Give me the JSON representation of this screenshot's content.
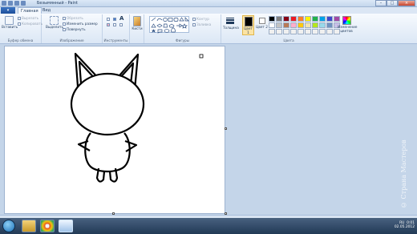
{
  "window": {
    "title": "Безымянный - Paint"
  },
  "tabs": {
    "file": "▾",
    "home": "Главная",
    "view": "Вид"
  },
  "clipboard": {
    "paste": "Вставить",
    "cut": "Вырезать",
    "copy": "Копировать",
    "label": "Буфер обмена"
  },
  "image": {
    "select": "Выделить",
    "crop": "Обрезать",
    "resize": "Изменить размер",
    "rotate": "Повернуть",
    "label": "Изображение"
  },
  "tools": {
    "label": "Инструменты",
    "text_glyph": "A"
  },
  "brushes": {
    "label": "Кисти"
  },
  "shapes": {
    "label": "Фигуры",
    "outline": "Контур",
    "fill": "Заливка"
  },
  "size": {
    "label": "Толщина"
  },
  "colors": {
    "color1": "Цвет 1",
    "color2": "Цвет 2",
    "edit": "Изменение цветов",
    "label": "Цвета",
    "palette": [
      "#000000",
      "#7f7f7f",
      "#880015",
      "#ed1c24",
      "#ff7f27",
      "#fff200",
      "#22b14c",
      "#00a2e8",
      "#3f48cc",
      "#a349a4",
      "#ffffff",
      "#c3c3c3",
      "#b97a57",
      "#ffaec9",
      "#ffc90e",
      "#efe4b0",
      "#b5e61d",
      "#99d9ea",
      "#7092be",
      "#c8bfe7",
      "#f0f0f0",
      "#f0f0f0",
      "#f0f0f0",
      "#f0f0f0",
      "#f0f0f0",
      "#f0f0f0",
      "#f0f0f0",
      "#f0f0f0",
      "#f0f0f0",
      "#f0f0f0"
    ]
  },
  "tray": {
    "lang": "RU",
    "time": "0:01",
    "date": "02.05.2012"
  },
  "watermark": "© Страна Мастеров"
}
